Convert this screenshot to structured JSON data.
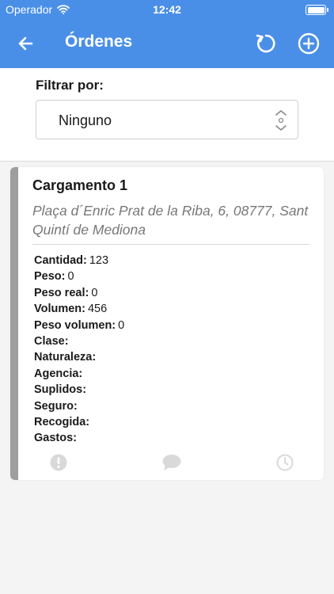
{
  "status_bar": {
    "carrier": "Operador",
    "time": "12:42",
    "battery_level": 1.0
  },
  "nav": {
    "title": "Órdenes",
    "back_icon": "back-arrow-icon",
    "refresh_icon": "refresh-icon",
    "add_icon": "add-circle-icon"
  },
  "filter": {
    "label": "Filtrar por:",
    "selected": "Ninguno"
  },
  "order": {
    "name": "Cargamento 1",
    "address": "Plaça d´Enric Prat de la Riba, 6, 08777, Sant Quintí de Mediona",
    "fields": [
      {
        "label": "Cantidad:",
        "value": "123"
      },
      {
        "label": "Peso:",
        "value": "0"
      },
      {
        "label": "Peso real:",
        "value": "0"
      },
      {
        "label": "Volumen:",
        "value": "456"
      },
      {
        "label": "Peso volumen:",
        "value": "0"
      },
      {
        "label": "Clase:",
        "value": ""
      },
      {
        "label": "Naturaleza:",
        "value": ""
      },
      {
        "label": "Agencia:",
        "value": ""
      },
      {
        "label": "Suplidos:",
        "value": ""
      },
      {
        "label": "Seguro:",
        "value": ""
      },
      {
        "label": "Recogida:",
        "value": ""
      },
      {
        "label": "Gastos:",
        "value": ""
      }
    ],
    "action_icons": [
      "alert-icon",
      "comment-icon",
      "clock-icon"
    ],
    "stripe_color": "#9e9e9e"
  },
  "colors": {
    "accent": "#4a8fe7",
    "background": "#f4f4f4",
    "icon_muted": "#d9d9d9"
  }
}
